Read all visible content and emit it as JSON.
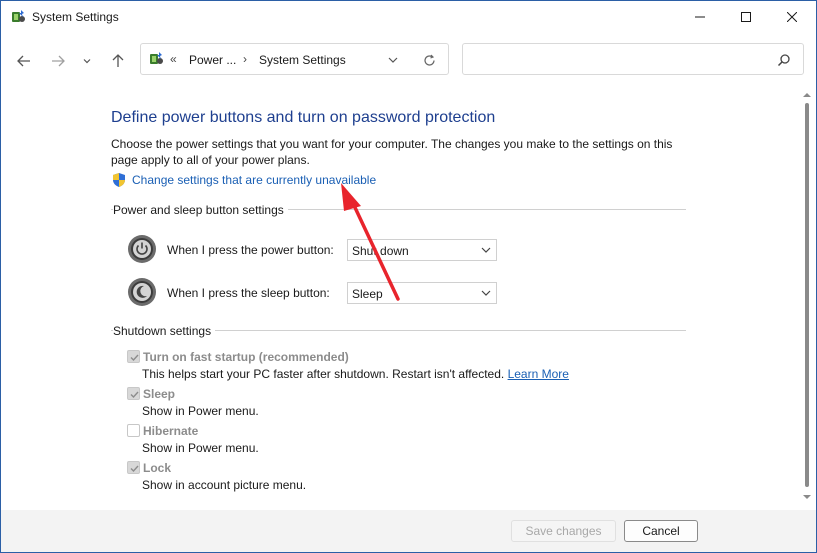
{
  "window": {
    "title": "System Settings",
    "accent": "#1e3f8f"
  },
  "titlebar": {
    "icons": {
      "app": "power-options-icon",
      "minimize": "minimize-icon",
      "maximize": "maximize-icon",
      "close": "close-icon"
    }
  },
  "nav": {
    "back": "back-arrow-icon",
    "forward": "forward-arrow-icon",
    "recent": "chevron-down-icon",
    "up": "up-arrow-icon",
    "address": {
      "overflow": "«",
      "crumb1": "Power ...",
      "separator": "›",
      "crumb2": "System Settings"
    },
    "search": {
      "placeholder": ""
    }
  },
  "content": {
    "heading": "Define power buttons and turn on password protection",
    "description": "Choose the power settings that you want for your computer. The changes you make to the settings on this page apply to all of your power plans.",
    "change_link": "Change settings that are currently unavailable",
    "power_section": {
      "label": "Power and sleep button settings",
      "rows": [
        {
          "label": "When I press the power button:",
          "value": "Shut down"
        },
        {
          "label": "When I press the sleep button:",
          "value": "Sleep"
        }
      ]
    },
    "shutdown_section": {
      "label": "Shutdown settings",
      "options": [
        {
          "label": "Turn on fast startup (recommended)",
          "checked": true,
          "description": "This helps start your PC faster after shutdown. Restart isn't affected.",
          "link": "Learn More"
        },
        {
          "label": "Sleep",
          "checked": true,
          "description": "Show in Power menu."
        },
        {
          "label": "Hibernate",
          "checked": false,
          "description": "Show in Power menu."
        },
        {
          "label": "Lock",
          "checked": true,
          "description": "Show in account picture menu."
        }
      ]
    }
  },
  "footer": {
    "save": "Save changes",
    "cancel": "Cancel"
  },
  "colors": {
    "link": "#1a5fb4",
    "annotation_arrow": "#e8242c",
    "disabled_text": "#8c8c8c"
  }
}
